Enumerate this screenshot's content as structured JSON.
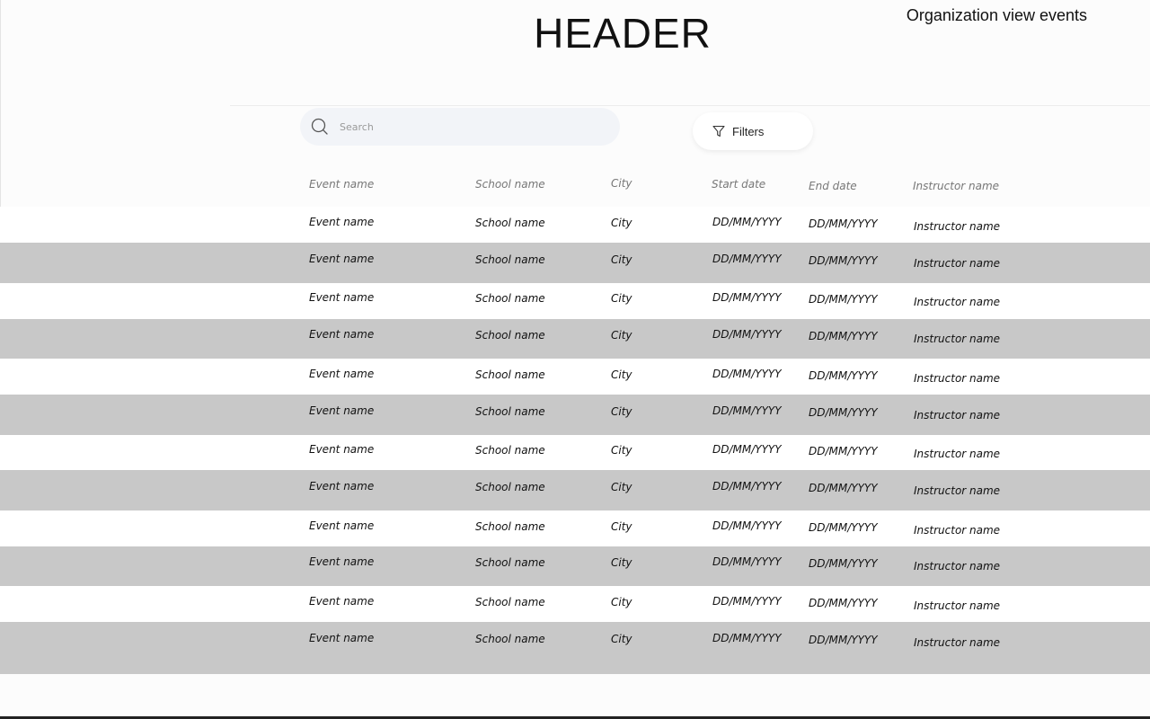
{
  "header": {
    "title": "HEADER",
    "page_label": "Organization view events"
  },
  "search": {
    "placeholder": "Search"
  },
  "filters": {
    "label": "Filters"
  },
  "table": {
    "columns": [
      "Event name",
      "School name",
      "City",
      "Start date",
      "End date",
      "Instructor name"
    ],
    "rows": [
      [
        "Event name",
        "School name",
        "City",
        "DD/MM/YYYY",
        "DD/MM/YYYY",
        "Instructor name"
      ],
      [
        "Event name",
        "School name",
        "City",
        "DD/MM/YYYY",
        "DD/MM/YYYY",
        "Instructor name"
      ],
      [
        "Event name",
        "School name",
        "City",
        "DD/MM/YYYY",
        "DD/MM/YYYY",
        "Instructor name"
      ],
      [
        "Event name",
        "School name",
        "City",
        "DD/MM/YYYY",
        "DD/MM/YYYY",
        "Instructor name"
      ],
      [
        "Event name",
        "School name",
        "City",
        "DD/MM/YYYY",
        "DD/MM/YYYY",
        "Instructor name"
      ],
      [
        "Event name",
        "School name",
        "City",
        "DD/MM/YYYY",
        "DD/MM/YYYY",
        "Instructor name"
      ],
      [
        "Event name",
        "School name",
        "City",
        "DD/MM/YYYY",
        "DD/MM/YYYY",
        "Instructor name"
      ],
      [
        "Event name",
        "School name",
        "City",
        "DD/MM/YYYY",
        "DD/MM/YYYY",
        "Instructor name"
      ],
      [
        "Event name",
        "School name",
        "City",
        "DD/MM/YYYY",
        "DD/MM/YYYY",
        "Instructor name"
      ],
      [
        "Event name",
        "School name",
        "City",
        "DD/MM/YYYY",
        "DD/MM/YYYY",
        "Instructor name"
      ],
      [
        "Event name",
        "School name",
        "City",
        "DD/MM/YYYY",
        "DD/MM/YYYY",
        "Instructor name"
      ],
      [
        "Event name",
        "School name",
        "City",
        "DD/MM/YYYY",
        "DD/MM/YYYY",
        "Instructor name"
      ]
    ]
  },
  "colors": {
    "row_alt": "#c8c8c8",
    "search_bg": "#f2f4f8"
  },
  "icons": {
    "search": "search-icon",
    "filter": "filter-icon"
  }
}
